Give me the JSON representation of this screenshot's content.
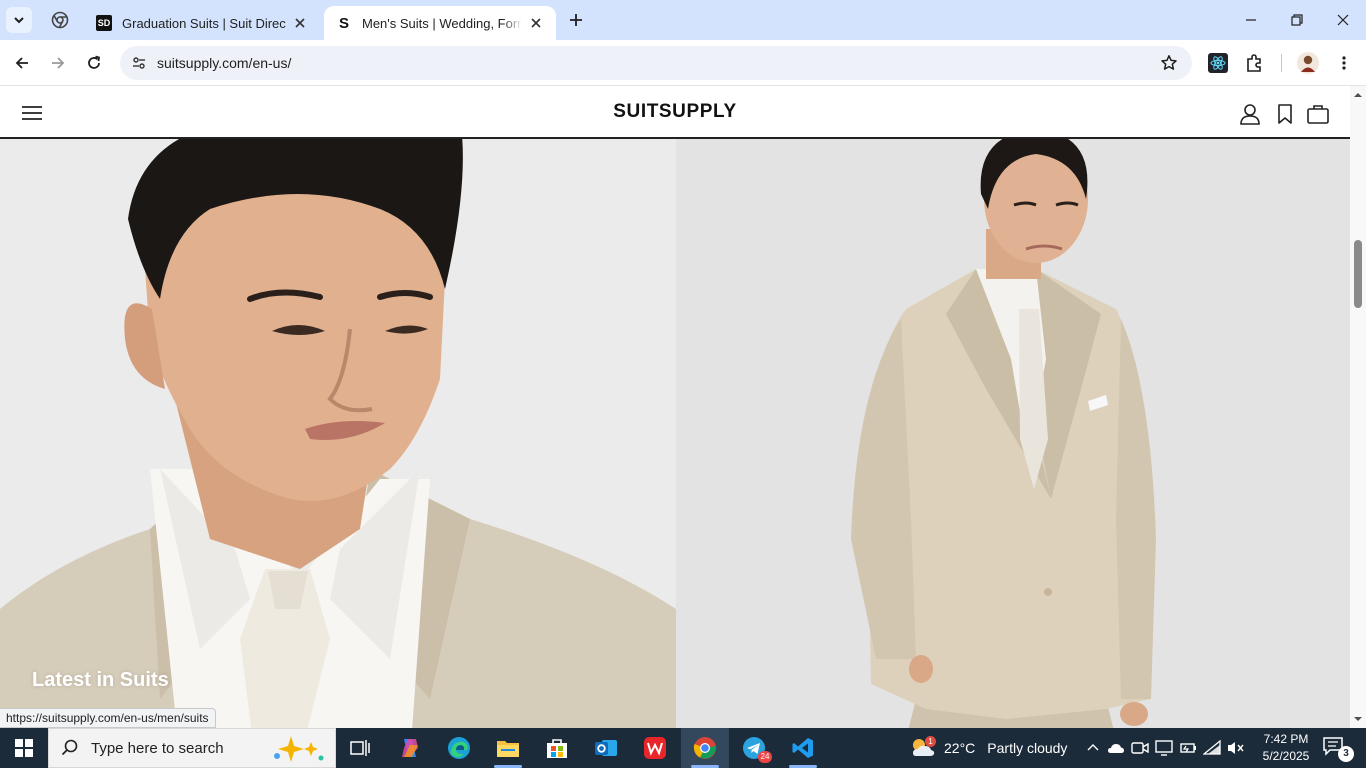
{
  "browser": {
    "tabs": [
      {
        "title": "Graduation Suits | Suit Direct",
        "favicon_text": "SD",
        "active": false
      },
      {
        "title": "Men's Suits | Wedding, Formal & Business",
        "favicon_text": "S",
        "active": true
      }
    ],
    "url": "suitsupply.com/en-us/",
    "status_url": "https://suitsupply.com/en-us/men/suits"
  },
  "site": {
    "logo": "SUITSUPPLY",
    "hero_left_title": "Latest in Suits"
  },
  "taskbar": {
    "search_placeholder": "Type here to search",
    "weather": {
      "temp": "22°C",
      "desc": "Partly cloudy",
      "badge": "1"
    },
    "telegram_badge": "24",
    "clock": {
      "time": "7:42 PM",
      "date": "5/2/2025"
    },
    "notification_count": "3"
  },
  "colors": {
    "tabstrip_bg": "#d3e3fd",
    "taskbar_bg": "#1c2b3a",
    "hero_left_bg": "#ebebeb",
    "hero_right_bg": "#e3e3e4",
    "suit_beige": "#d9cdb8"
  }
}
